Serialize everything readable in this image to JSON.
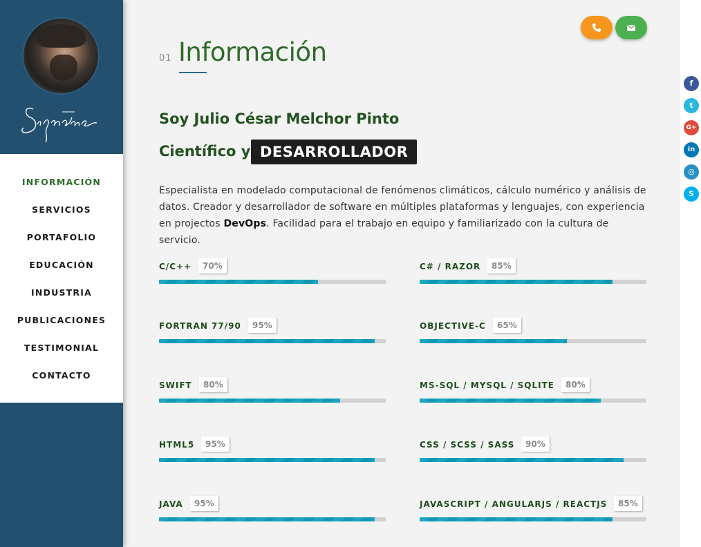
{
  "sidebar": {
    "signature_text": "Signature",
    "nav": [
      {
        "label": "INFORMACIÓN",
        "active": true
      },
      {
        "label": "SERVICIOS",
        "active": false
      },
      {
        "label": "PORTAFOLIO",
        "active": false
      },
      {
        "label": "EDUCACIÓN",
        "active": false
      },
      {
        "label": "INDUSTRIA",
        "active": false
      },
      {
        "label": "PUBLICACIONES",
        "active": false
      },
      {
        "label": "TESTIMONIAL",
        "active": false
      },
      {
        "label": "CONTACTO",
        "active": false
      }
    ]
  },
  "section": {
    "number": "01",
    "title": "Información"
  },
  "intro": {
    "name_line": "Soy Julio César Melchor Pinto",
    "role_prefix": "Científico y",
    "role_highlight": "DESARROLLADOR",
    "description_part1": "Especialista en modelado computacional de fenómenos climáticos, cálculo numérico y análisis de datos. Creador y desarrollador de software en múltiples plataformas y lenguajes, con experiencia en projectos ",
    "description_bold": "DevOps",
    "description_part2": ". Facilidad para el trabajo en equipo y familiarizado con la cultura de servicio."
  },
  "skills": [
    {
      "label": "C/C++",
      "pct": "70%",
      "value": 70
    },
    {
      "label": "C# / RAZOR",
      "pct": "85%",
      "value": 85
    },
    {
      "label": "FORTRAN 77/90",
      "pct": "95%",
      "value": 95
    },
    {
      "label": "OBJECTIVE-C",
      "pct": "65%",
      "value": 65
    },
    {
      "label": "SWIFT",
      "pct": "80%",
      "value": 80
    },
    {
      "label": "MS-SQL / MYSQL / SQLITE",
      "pct": "80%",
      "value": 80
    },
    {
      "label": "HTML5",
      "pct": "95%",
      "value": 95
    },
    {
      "label": "CSS / SCSS / SASS",
      "pct": "90%",
      "value": 90
    },
    {
      "label": "JAVA",
      "pct": "95%",
      "value": 95
    },
    {
      "label": "JAVASCRIPT / ANGULARJS / REACTJS",
      "pct": "85%",
      "value": 85
    }
  ],
  "contact_buttons": {
    "phone": {
      "icon": "phone-icon",
      "color": "#f7961d"
    },
    "email": {
      "icon": "envelope-icon",
      "color": "#4caf50"
    }
  },
  "social": [
    {
      "icon": "facebook-icon",
      "glyph": "f",
      "color": "#3b5998"
    },
    {
      "icon": "twitter-icon",
      "glyph": "t",
      "color": "#29b6e0"
    },
    {
      "icon": "google-plus-icon",
      "glyph": "G+",
      "color": "#dd4b39"
    },
    {
      "icon": "linkedin-icon",
      "glyph": "in",
      "color": "#0077b5"
    },
    {
      "icon": "instagram-icon",
      "glyph": "◎",
      "color": "#2a8fc4"
    },
    {
      "icon": "skype-icon",
      "glyph": "S",
      "color": "#00aff0"
    }
  ],
  "colors": {
    "sidebar": "#23506f",
    "accent_green": "#2e6b2a",
    "bar": "#1aa6c2"
  }
}
